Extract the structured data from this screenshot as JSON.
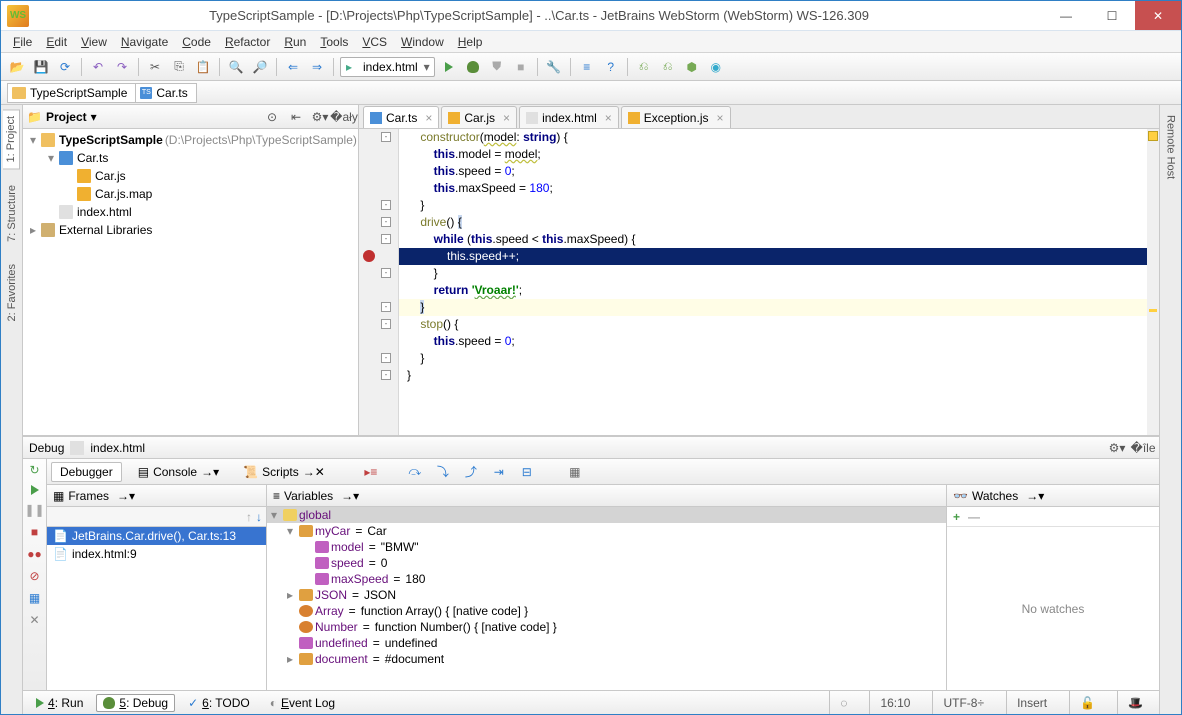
{
  "window": {
    "title": "TypeScriptSample - [D:\\Projects\\Php\\TypeScriptSample] - ..\\Car.ts - JetBrains WebStorm (WebStorm) WS-126.309"
  },
  "menu": [
    "File",
    "Edit",
    "View",
    "Navigate",
    "Code",
    "Refactor",
    "Run",
    "Tools",
    "VCS",
    "Window",
    "Help"
  ],
  "runConfig": "index.html",
  "breadcrumbs": [
    {
      "icon": "folder",
      "label": "TypeScriptSample"
    },
    {
      "icon": "ts",
      "label": "Car.ts"
    }
  ],
  "projectPanel": {
    "title": "Project",
    "tree": [
      {
        "depth": 0,
        "tw": "▾",
        "icon": "folder",
        "name": "TypeScriptSample",
        "bold": true,
        "path": " (D:\\Projects\\Php\\TypeScriptSample)"
      },
      {
        "depth": 1,
        "tw": "▾",
        "icon": "ts",
        "name": "Car.ts"
      },
      {
        "depth": 2,
        "tw": "",
        "icon": "js",
        "name": "Car.js"
      },
      {
        "depth": 2,
        "tw": "",
        "icon": "js",
        "name": "Car.js.map"
      },
      {
        "depth": 1,
        "tw": "",
        "icon": "html",
        "name": "index.html"
      },
      {
        "depth": 0,
        "tw": "▸",
        "icon": "lib",
        "name": "External Libraries"
      }
    ]
  },
  "leftGutters": [
    {
      "label": "1: Project",
      "active": true
    },
    {
      "label": "7: Structure",
      "active": false
    },
    {
      "label": "2: Favorites",
      "active": false
    }
  ],
  "rightGutter": "Remote Host",
  "editorTabs": [
    {
      "icon": "ts",
      "label": "Car.ts",
      "active": true
    },
    {
      "icon": "js",
      "label": "Car.js",
      "active": false
    },
    {
      "icon": "html",
      "label": "index.html",
      "active": false
    },
    {
      "icon": "js",
      "label": "Exception.js",
      "active": false
    }
  ],
  "code": {
    "lines": [
      {
        "y": 0,
        "html": "    <span class='fn'>constructor</span>(<span class='under'>model</span>: <span class='kw'>string</span>) {"
      },
      {
        "y": 1,
        "html": "        <span class='kw'>this</span>.model = <span class='under'>model</span>;"
      },
      {
        "y": 2,
        "html": "        <span class='kw'>this</span>.speed = <span class='num'>0</span>;"
      },
      {
        "y": 3,
        "html": "        <span class='kw'>this</span>.maxSpeed = <span class='num'>180</span>;"
      },
      {
        "y": 4,
        "html": "    }"
      },
      {
        "y": 5,
        "html": "    <span class='fn'>drive</span>() <span style='background:#c8d8f0'>{</span>"
      },
      {
        "y": 6,
        "html": "        <span class='kw'>while</span> (<span class='kw'>this</span>.speed &lt; <span class='kw'>this</span>.maxSpeed) {"
      },
      {
        "y": 7,
        "sel": true,
        "html": "            this.speed++;"
      },
      {
        "y": 8,
        "html": "        }"
      },
      {
        "y": 9,
        "html": "        <span class='kw'>return</span> <span class='str'>'<span style='text-decoration:underline wavy #6aa84f'>Vroaar!</span>'</span>;"
      },
      {
        "y": 10,
        "hl": true,
        "html": "    <span style='background:#c8d8f0'>}</span>"
      },
      {
        "y": 11,
        "html": "    <span class='fn'>stop</span>() {"
      },
      {
        "y": 12,
        "html": "        <span class='kw'>this</span>.speed = <span class='num'>0</span>;"
      },
      {
        "y": 13,
        "html": "    }"
      },
      {
        "y": 14,
        "html": "}"
      }
    ],
    "breakpointAt": 7,
    "folds": [
      0,
      4,
      5,
      6,
      8,
      10,
      11,
      13,
      14
    ]
  },
  "debug": {
    "title": "Debug",
    "target": "index.html",
    "tabs": [
      "Debugger",
      "Console",
      "Scripts"
    ],
    "frames": {
      "title": "Frames",
      "items": [
        {
          "label": "JetBrains.Car.drive(), Car.ts:13",
          "sel": true
        },
        {
          "label": "index.html:9",
          "sel": false
        }
      ]
    },
    "variables": {
      "title": "Variables",
      "rows": [
        {
          "depth": 0,
          "tw": "▾",
          "vico": "g",
          "k": "global",
          "hdr": true
        },
        {
          "depth": 1,
          "tw": "▾",
          "vico": "o",
          "k": "myCar",
          "v": "Car"
        },
        {
          "depth": 2,
          "tw": "",
          "vico": "p",
          "k": "model",
          "v": "\"BMW\""
        },
        {
          "depth": 2,
          "tw": "",
          "vico": "p",
          "k": "speed",
          "v": "0"
        },
        {
          "depth": 2,
          "tw": "",
          "vico": "p",
          "k": "maxSpeed",
          "v": "180"
        },
        {
          "depth": 1,
          "tw": "▸",
          "vico": "o",
          "k": "JSON",
          "v": "JSON"
        },
        {
          "depth": 1,
          "tw": "",
          "vico": "m",
          "k": "Array",
          "v": "function Array() { [native code] }"
        },
        {
          "depth": 1,
          "tw": "",
          "vico": "m",
          "k": "Number",
          "v": "function Number() { [native code] }"
        },
        {
          "depth": 1,
          "tw": "",
          "vico": "p",
          "k": "undefined",
          "v": "undefined"
        },
        {
          "depth": 1,
          "tw": "▸",
          "vico": "o",
          "k": "document",
          "v": "#document"
        }
      ]
    },
    "watches": {
      "title": "Watches",
      "empty": "No watches"
    }
  },
  "status": {
    "buttons": [
      {
        "label": "4: Run",
        "icon": "play"
      },
      {
        "label": "5: Debug",
        "icon": "bug",
        "active": true
      },
      {
        "label": "6: TODO",
        "icon": "todo"
      },
      {
        "label": "Event Log",
        "icon": "log"
      }
    ],
    "pos": "16:10",
    "encoding": "UTF-8",
    "mode": "Insert"
  }
}
